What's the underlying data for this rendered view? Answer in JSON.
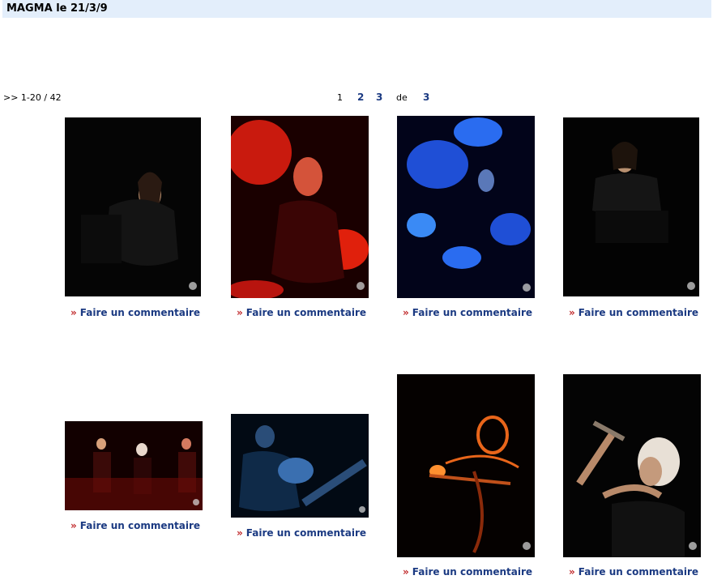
{
  "page_title": "MAGMA le 21/3/9",
  "pagination": {
    "range": ">> 1-20 / 42",
    "current_page": "1",
    "page_2": "2",
    "page_3": "3",
    "of_label": "de",
    "total_pages": "3"
  },
  "gallery": {
    "comment_arrow": "»",
    "comment_label": "Faire un commentaire"
  },
  "colors": {
    "header_bg": "#e3eefb",
    "link": "#1b3a82",
    "arrow": "#c0282a"
  }
}
